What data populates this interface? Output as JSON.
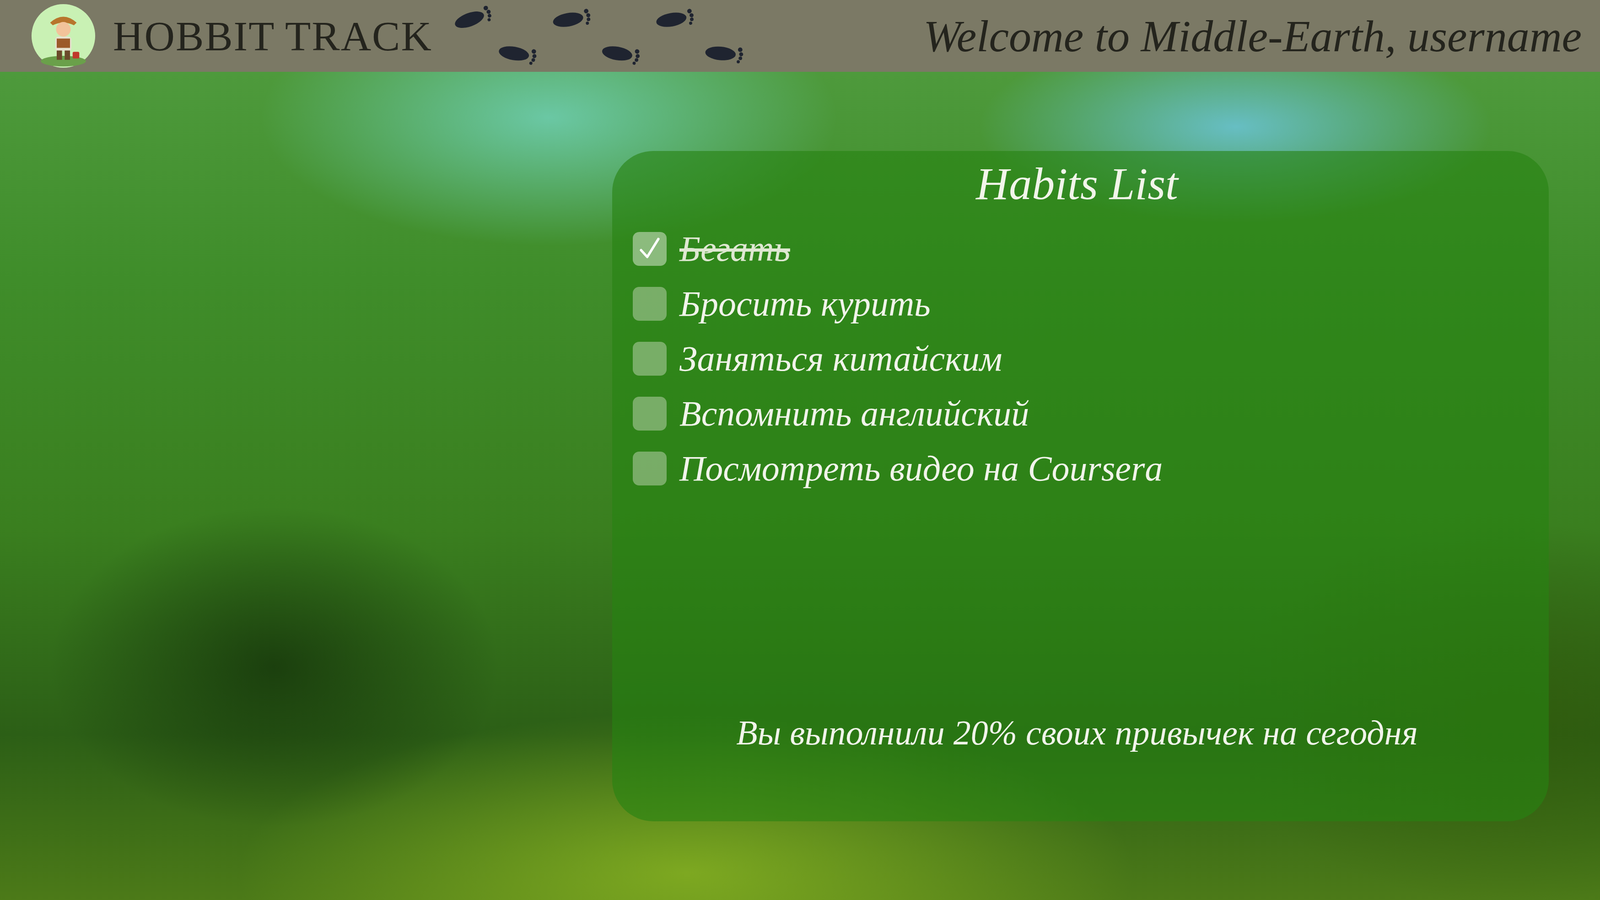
{
  "header": {
    "app_name": "HOBBIT TRACK",
    "greeting": "Welcome to Middle-Earth, username"
  },
  "panel": {
    "title": "Habits List",
    "habits": [
      {
        "name": "Бегать",
        "checked": true
      },
      {
        "name": "Бросить курить",
        "checked": false
      },
      {
        "name": "Заняться китайским",
        "checked": false
      },
      {
        "name": "Вспомнить английский",
        "checked": false
      },
      {
        "name": "Посмотреть видео на Coursera",
        "checked": false
      }
    ],
    "summary": "Вы выполнили 20% своих привычек на сегодня"
  }
}
